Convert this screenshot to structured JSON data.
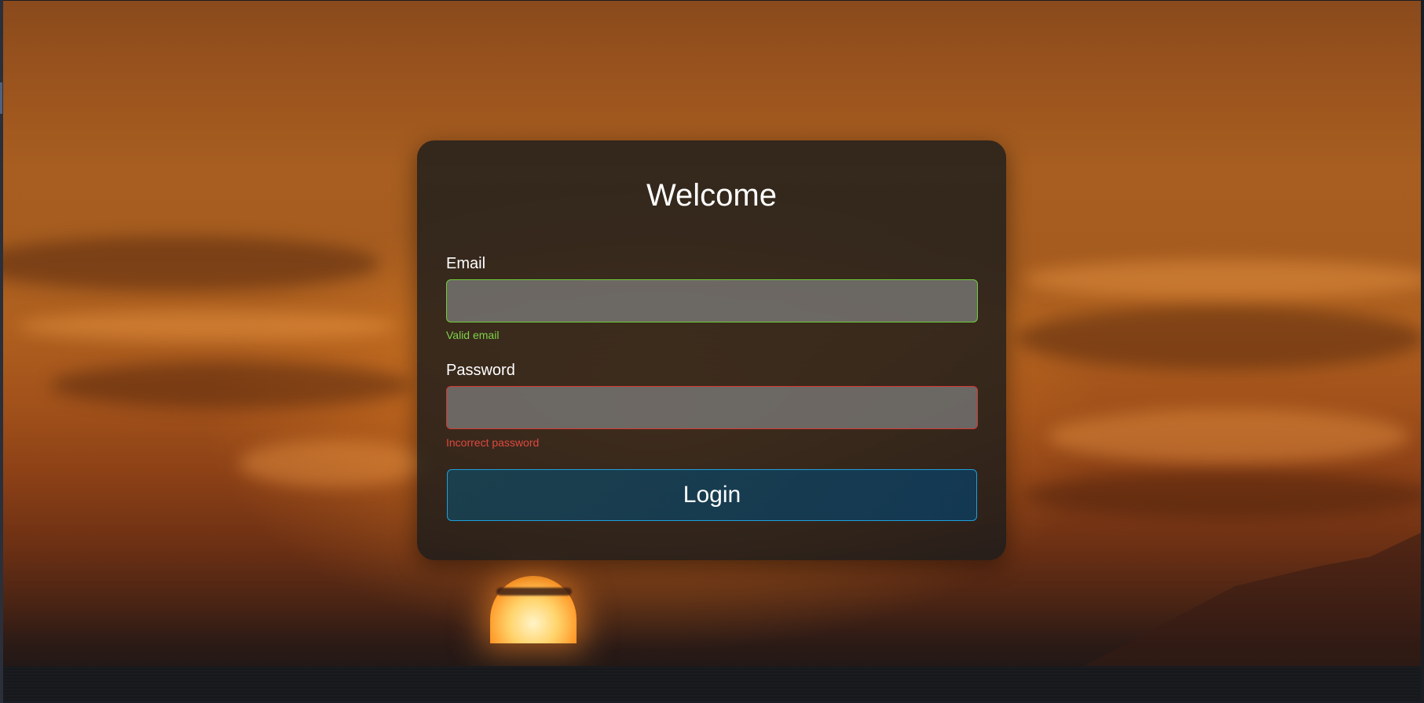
{
  "login": {
    "title": "Welcome",
    "email": {
      "label": "Email",
      "value": "",
      "placeholder": "",
      "status": "valid",
      "message": "Valid email",
      "border_color": "#6fce3a"
    },
    "password": {
      "label": "Password",
      "value": "",
      "placeholder": "",
      "status": "invalid",
      "message": "Incorrect password",
      "border_color": "#d23a32"
    },
    "submit_label": "Login",
    "submit_border_color": "#1e9fdc"
  },
  "background": {
    "description": "sunset over the sea",
    "sky_color": "#a85e20",
    "sun_color": "#ffd36a"
  }
}
